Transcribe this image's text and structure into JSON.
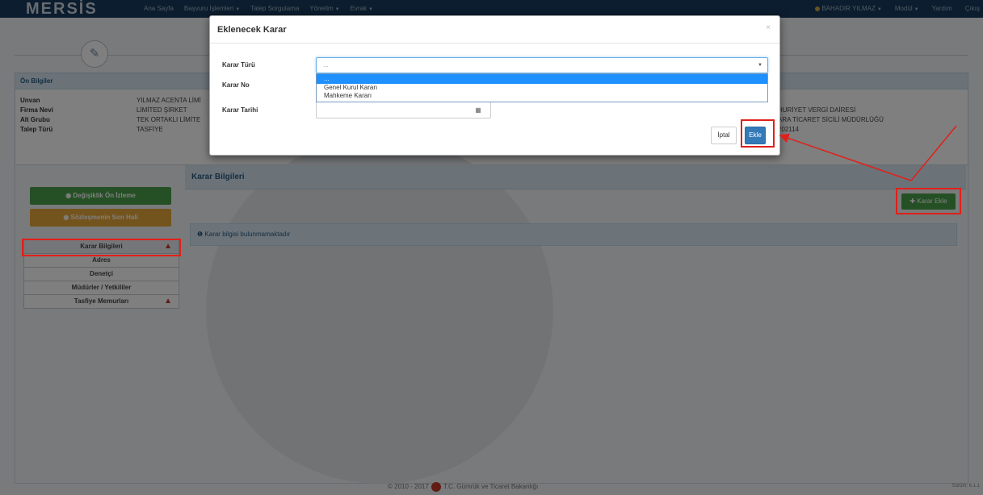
{
  "navbar": {
    "logo": "MERSİS",
    "items": [
      {
        "label": "Ana Sayfa",
        "has_caret": false
      },
      {
        "label": "Başvuru İşlemleri",
        "has_caret": true
      },
      {
        "label": "Talep Sorgulama",
        "has_caret": false
      },
      {
        "label": "Yönetim",
        "has_caret": true
      },
      {
        "label": "Evrak",
        "has_caret": true
      }
    ],
    "user": "BAHADIR YILMAZ",
    "modul": "Modül",
    "yardim": "Yardım",
    "cikis": "Çıkış"
  },
  "on_bilgiler": {
    "title": "Ön Bilgiler",
    "rows": [
      {
        "key": "Unvan",
        "value": "YILMAZ ACENTA LİMİ"
      },
      {
        "key": "Firma Nevi",
        "value": "LİMİTED ŞİRKET"
      },
      {
        "key": "Alt Grubu",
        "value": "TEK ORTAKLI LİMİTE"
      },
      {
        "key": "Talep Türü",
        "value": "TASFİYE"
      }
    ],
    "right_values": [
      "HURİYET VERGİ DAİRESİ",
      "ARA TİCARET SİCİLİ MÜDÜRLÜĞÜ",
      "202114"
    ]
  },
  "sidebar": {
    "degisiklik_label": "Değişiklik Ön İzleme",
    "sozlesme_label": "Sözleşmenin Son Hali",
    "items": [
      {
        "label": "Karar Bilgileri",
        "warning": true
      },
      {
        "label": "Adres",
        "warning": false
      },
      {
        "label": "Denetçi",
        "warning": false
      },
      {
        "label": "Müdürler / Yetkililer",
        "warning": false
      },
      {
        "label": "Tasfiye Memurları",
        "warning": true
      }
    ]
  },
  "main": {
    "header": "Karar Bilgileri",
    "add_button": "Karar Ekle",
    "info_message": "Karar bilgisi bulunmamaktadır"
  },
  "modal": {
    "title": "Eklenecek Karar",
    "close_symbol": "×",
    "karar_turu_label": "Karar Türü",
    "karar_turu_value": "...",
    "karar_no_label": "Karar No",
    "karar_tarihi_label": "Karar Tarihi",
    "dropdown_options": [
      "...",
      "Genel Kurul Kararı",
      "Mahkeme Kararı"
    ],
    "iptal_label": "İptal",
    "ekle_label": "Ekle"
  },
  "footer": {
    "years": "© 2010 - 2017",
    "ministry": "T.C. Gümrük ve Ticaret Bakanlığı",
    "version": "Sürüm: 6.1.1"
  },
  "colors": {
    "navbar": "#163a5c",
    "primary": "#337ab7",
    "success": "#4aa04a",
    "warning": "#e8a83a",
    "highlight": "#e0201a",
    "select_highlight": "#1e90ff"
  }
}
